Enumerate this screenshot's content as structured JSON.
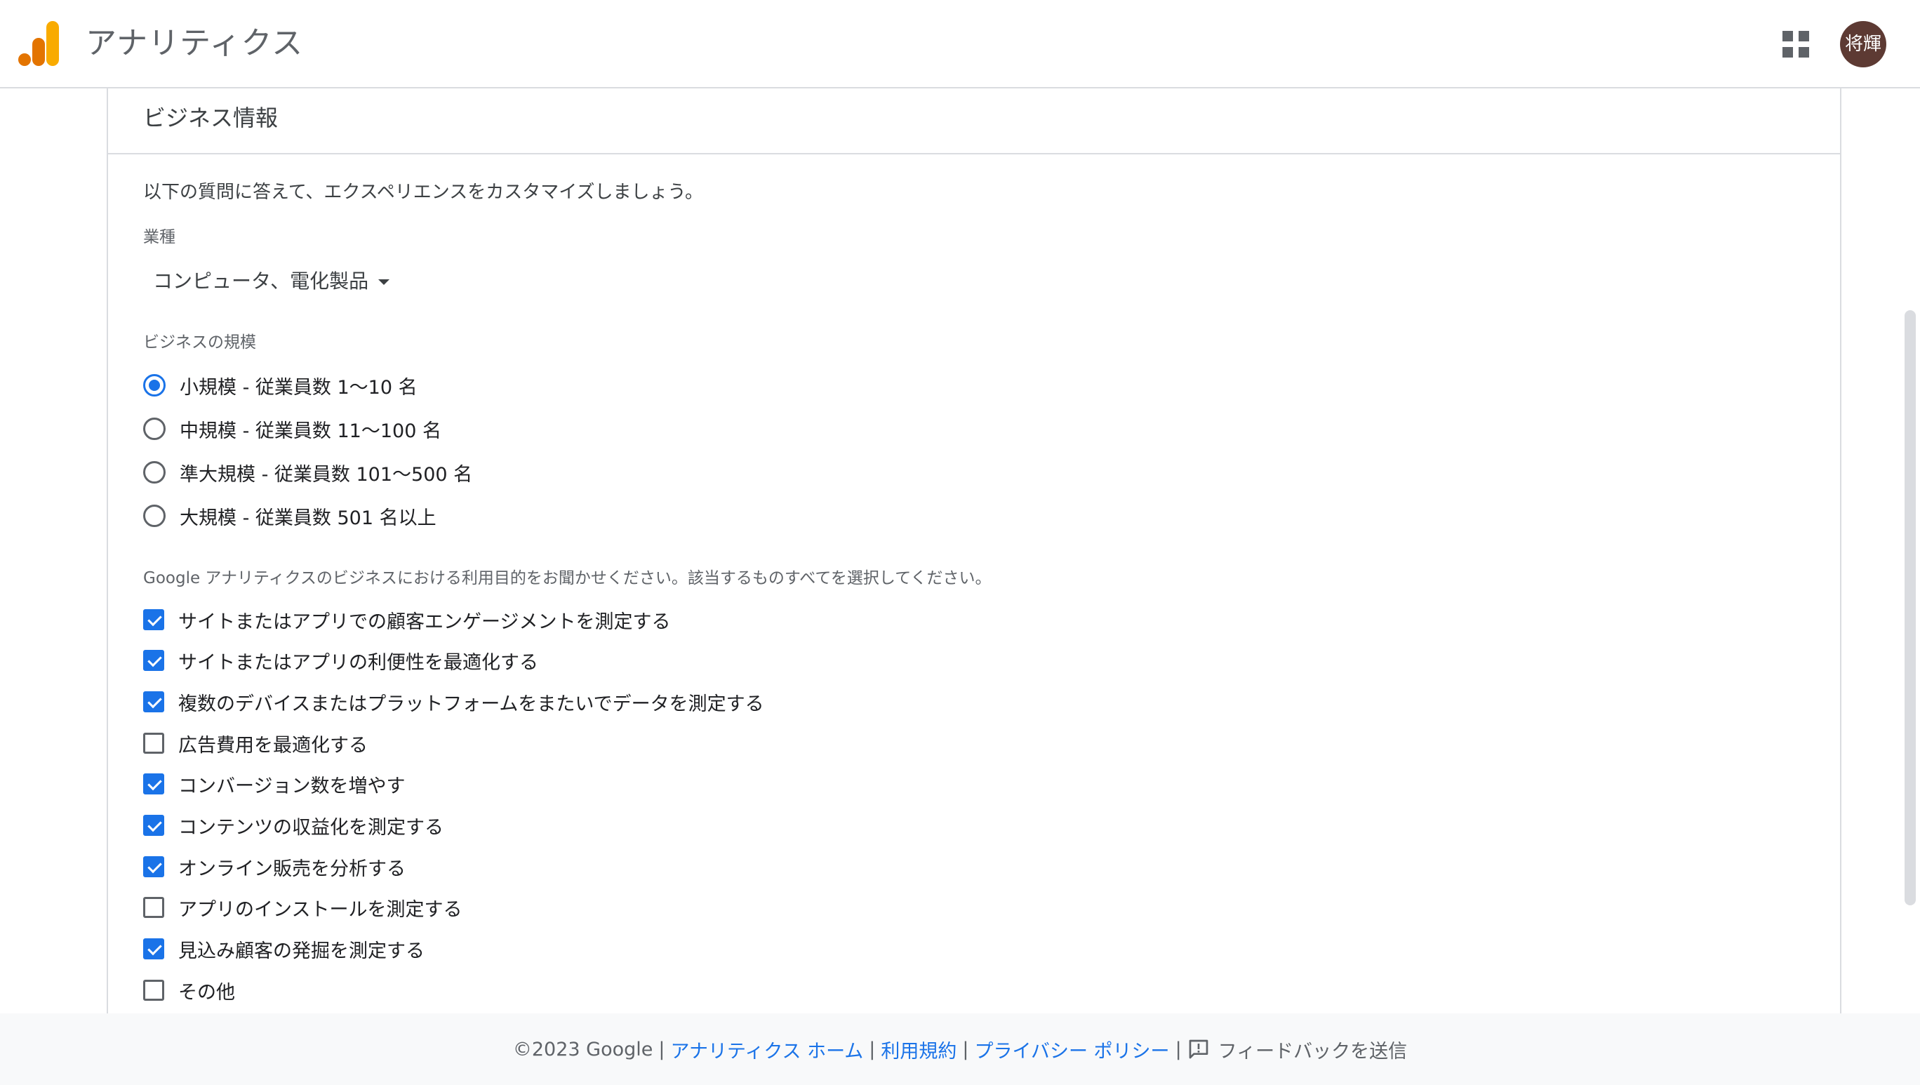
{
  "header": {
    "app_title": "アナリティクス",
    "avatar_text": "将輝",
    "brand_colors": [
      "#F9AB00",
      "#E37400"
    ]
  },
  "section": {
    "title": "ビジネス情報",
    "intro": "以下の質問に答えて、エクスペリエンスをカスタマイズしましょう。"
  },
  "industry": {
    "label": "業種",
    "selected": "コンピュータ、電化製品"
  },
  "business_size": {
    "label": "ビジネスの規模",
    "options": [
      {
        "label": "小規模 - 従業員数 1～10 名",
        "checked": true
      },
      {
        "label": "中規模 - 従業員数 11～100 名",
        "checked": false
      },
      {
        "label": "準大規模 - 従業員数 101～500 名",
        "checked": false
      },
      {
        "label": "大規模 - 従業員数 501 名以上",
        "checked": false
      }
    ]
  },
  "usage": {
    "label": "Google アナリティクスのビジネスにおける利用目的をお聞かせください。該当するものすべてを選択してください。",
    "options": [
      {
        "label": "サイトまたはアプリでの顧客エンゲージメントを測定する",
        "checked": true
      },
      {
        "label": "サイトまたはアプリの利便性を最適化する",
        "checked": true
      },
      {
        "label": "複数のデバイスまたはプラットフォームをまたいでデータを測定する",
        "checked": true
      },
      {
        "label": "広告費用を最適化する",
        "checked": false
      },
      {
        "label": "コンバージョン数を増やす",
        "checked": true
      },
      {
        "label": "コンテンツの収益化を測定する",
        "checked": true
      },
      {
        "label": "オンライン販売を分析する",
        "checked": true
      },
      {
        "label": "アプリのインストールを測定する",
        "checked": false
      },
      {
        "label": "見込み顧客の発掘を測定する",
        "checked": true
      },
      {
        "label": "その他",
        "checked": false
      }
    ]
  },
  "footer": {
    "copyright": "©2023 Google",
    "home_link": "アナリティクス ホーム",
    "terms_link": "利用規約",
    "privacy_link": "プライバシー ポリシー",
    "feedback": "フィードバックを送信",
    "separator": "|"
  },
  "colors": {
    "accent": "#1a73e8",
    "footer_bg": "#f8f9fa",
    "avatar_bg": "#5d3a33"
  }
}
